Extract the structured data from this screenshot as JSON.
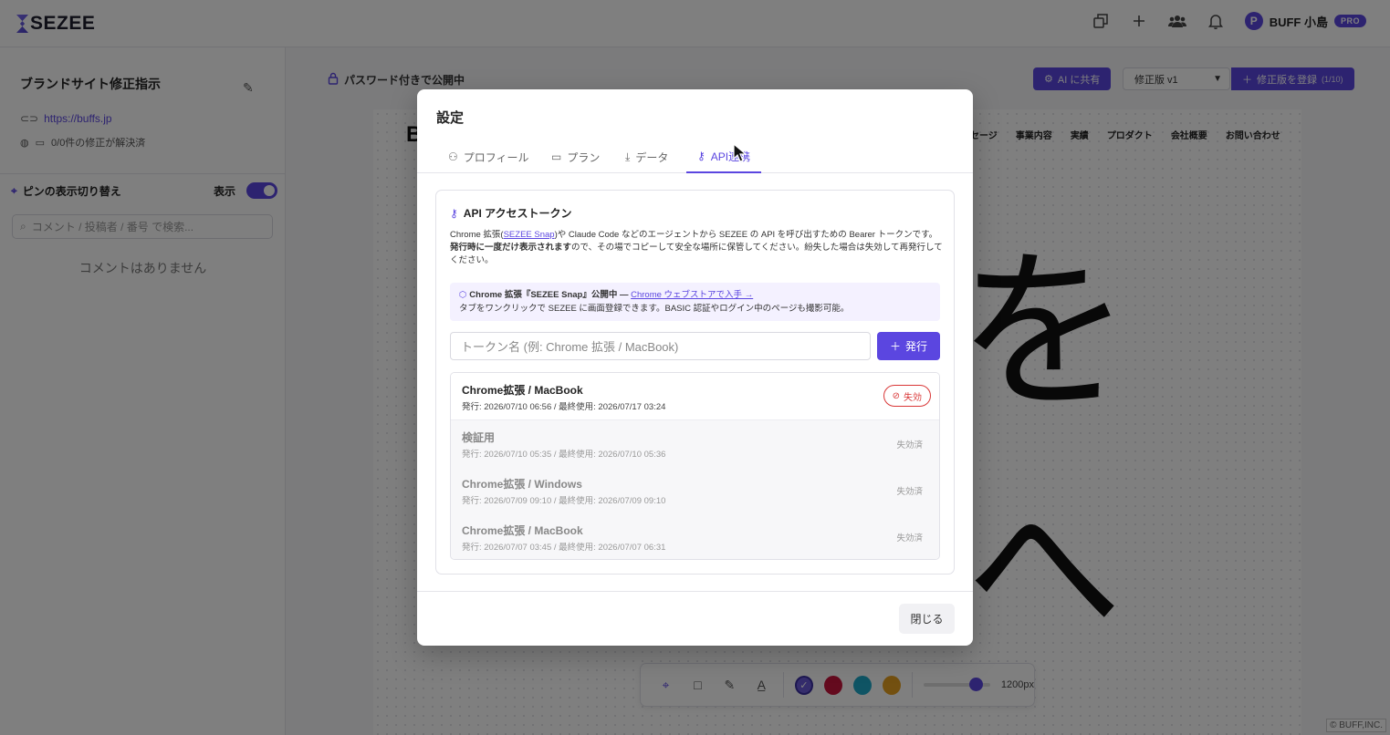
{
  "app": {
    "logo": "SEZEE",
    "user_name": "BUFF 小島",
    "user_initial": "P",
    "plan_badge": "PRO"
  },
  "sidebar": {
    "project_title": "ブランドサイト修正指示",
    "project_url": "https://buffs.jp",
    "fix_status": "0/0件の修正が解決済",
    "pin_toggle_label": "ピンの表示切り替え",
    "pin_toggle_state": "表示",
    "search_placeholder": "コメント / 投稿者 / 番号 で検索...",
    "empty_text": "コメントはありません"
  },
  "main": {
    "visibility": "パスワード付きで公開中",
    "ai_share": "AI に共有",
    "version": "修正版 v1",
    "register": "修正版を登録",
    "register_count": "(1/10)",
    "site_nav": [
      "ッセージ",
      "事業内容",
      "実績",
      "プロダクト",
      "会社概要",
      "お問い合わせ"
    ],
    "site_logo_fragment": "B",
    "handwriting_1": "を",
    "handwriting_2": "へ",
    "zoom": "1200px",
    "swatches": [
      "#6a5bd8",
      "#c8143c",
      "#1fa9c9",
      "#e6a020"
    ],
    "copyright": "© BUFF,INC."
  },
  "modal": {
    "title": "設定",
    "tabs": [
      "プロフィール",
      "プラン",
      "データ",
      "API連携"
    ],
    "active_tab": "API連携",
    "section_title": "API アクセストークン",
    "desc_1a": "Chrome 拡張(",
    "desc_1_link": "SEZEE Snap",
    "desc_1b": ")や Claude Code などのエージェントから SEZEE の API を呼び出すための Bearer トークンです。",
    "desc_2_bold": "発行時に一度だけ表示されます",
    "desc_2_rest": "ので、その場でコピーして安全な場所に保管してください。紛失した場合は失効して再発行してください。",
    "notice_title": "Chrome 拡張『SEZEE Snap』公開中 — ",
    "notice_link": "Chrome ウェブストアで入手 →",
    "notice_body": "タブをワンクリックで SEZEE に画面登録できます。BASIC 認証やログイン中のページも撮影可能。",
    "token_placeholder": "トークン名 (例: Chrome 拡張 / MacBook)",
    "issue_button": "発行",
    "tokens": [
      {
        "name": "Chrome拡張 / MacBook",
        "meta": "発行: 2026/07/10 06:56  /  最終使用: 2026/07/17 03:24",
        "action": "失効"
      },
      {
        "name": "検証用",
        "meta": "発行: 2026/07/10 05:35  /  最終使用: 2026/07/10 05:36",
        "status": "失効済"
      },
      {
        "name": "Chrome拡張 / Windows",
        "meta": "発行: 2026/07/09 09:10  /  最終使用: 2026/07/09 09:10",
        "status": "失効済"
      },
      {
        "name": "Chrome拡張 / MacBook",
        "meta": "発行: 2026/07/07 03:45  /  最終使用: 2026/07/07 06:31",
        "status": "失効済"
      }
    ],
    "close_button": "閉じる"
  }
}
